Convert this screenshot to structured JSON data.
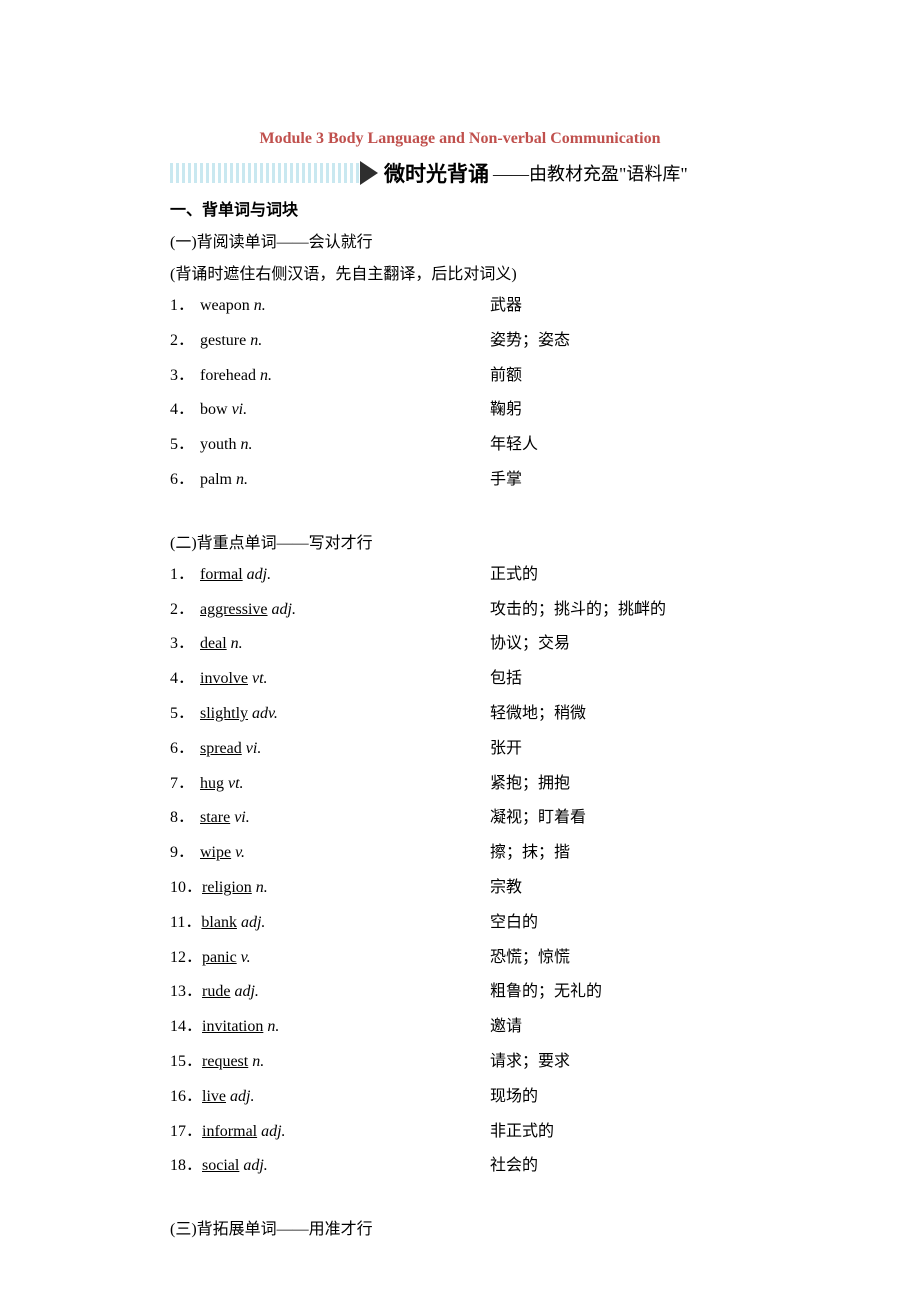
{
  "module_title": "Module 3 Body Language and Non-verbal Communication",
  "banner": {
    "main": "微时光背诵",
    "sub": "——由教材充盈\"语料库\""
  },
  "section1": {
    "heading": "一、背单词与词块",
    "sub1": {
      "heading": "(一)背阅读单词——会认就行",
      "note": "(背诵时遮住右侧汉语，先自主翻译，后比对词义)",
      "items": [
        {
          "n": "1．",
          "w": "weapon",
          "pos": "n.",
          "m": "武器"
        },
        {
          "n": "2．",
          "w": "gesture",
          "pos": "n.",
          "m": "姿势；姿态"
        },
        {
          "n": "3．",
          "w": "forehead",
          "pos": "n.",
          "m": "前额"
        },
        {
          "n": "4．",
          "w": "bow",
          "pos": "vi.",
          "m": "鞠躬"
        },
        {
          "n": "5．",
          "w": "youth",
          "pos": "n.",
          "m": "年轻人"
        },
        {
          "n": "6．",
          "w": "palm",
          "pos": "n.",
          "m": "手掌"
        }
      ]
    },
    "sub2": {
      "heading": "(二)背重点单词——写对才行",
      "items": [
        {
          "n": "1．",
          "w": "formal",
          "pos": "adj.",
          "m": "正式的"
        },
        {
          "n": "2．",
          "w": "aggressive",
          "pos": "adj.",
          "m": "攻击的；挑斗的；挑衅的"
        },
        {
          "n": "3．",
          "w": "deal",
          "pos": "n.",
          "m": "协议；交易"
        },
        {
          "n": "4．",
          "w": "involve",
          "pos": "vt.",
          "m": "包括"
        },
        {
          "n": "5．",
          "w": "slightly",
          "pos": "adv.",
          "m": "轻微地；稍微"
        },
        {
          "n": "6．",
          "w": "spread",
          "pos": "vi.",
          "m": "张开"
        },
        {
          "n": "7．",
          "w": "hug",
          "pos": "vt.",
          "m": "紧抱；拥抱"
        },
        {
          "n": "8．",
          "w": "stare",
          "pos": "vi.",
          "m": "凝视；盯着看"
        },
        {
          "n": "9．",
          "w": "wipe",
          "pos": "v.",
          "m": "擦；抹；揩"
        },
        {
          "n": "10．",
          "w": "religion",
          "pos": "n.",
          "m": "宗教"
        },
        {
          "n": "11．",
          "w": "blank",
          "pos": "adj.",
          "m": "空白的"
        },
        {
          "n": "12．",
          "w": "panic",
          "pos": "v.",
          "m": "恐慌；惊慌"
        },
        {
          "n": "13．",
          "w": "rude",
          "pos": "adj.",
          "m": "粗鲁的；无礼的"
        },
        {
          "n": "14．",
          "w": "invitation",
          "pos": "n.",
          "m": "邀请"
        },
        {
          "n": "15．",
          "w": "request",
          "pos": "n.",
          "m": "请求；要求"
        },
        {
          "n": "16．",
          "w": "live",
          "pos": "adj.",
          "m": "现场的"
        },
        {
          "n": "17．",
          "w": "informal",
          "pos": "adj.",
          "m": "非正式的"
        },
        {
          "n": "18．",
          "w": "social",
          "pos": "adj.",
          "m": "社会的"
        }
      ]
    },
    "sub3": {
      "heading": "(三)背拓展单词——用准才行"
    }
  }
}
